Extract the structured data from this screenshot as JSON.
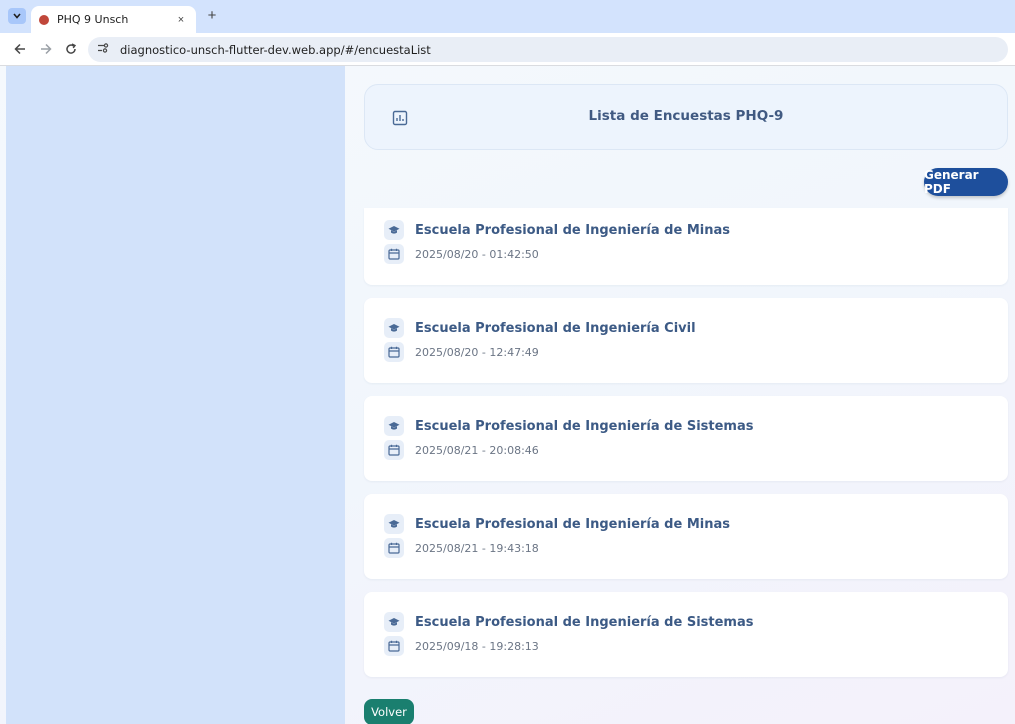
{
  "browser": {
    "tab_title": "PHQ 9 Unsch",
    "tab_close": "×",
    "new_tab": "+",
    "url": "diagnostico-unsch-flutter-dev.web.app/#/encuestaList"
  },
  "header": {
    "title": "Lista de Encuestas PHQ-9"
  },
  "actions": {
    "pdf_label": "Generar PDF",
    "back_label": "Volver"
  },
  "surveys": [
    {
      "school": "Escuela Profesional de Ingeniería de Minas",
      "date": "2025/08/20 - 01:42:50"
    },
    {
      "school": "Escuela Profesional de Ingeniería Civil",
      "date": "2025/08/20 - 12:47:49"
    },
    {
      "school": "Escuela Profesional de Ingeniería de Sistemas",
      "date": "2025/08/21 - 20:08:46"
    },
    {
      "school": "Escuela Profesional de Ingeniería de Minas",
      "date": "2025/08/21 - 19:43:18"
    },
    {
      "school": "Escuela Profesional de Ingeniería de Sistemas",
      "date": "2025/09/18 - 19:28:13"
    }
  ],
  "colors": {
    "primary": "#1e4f9c",
    "back_button": "#1a7f6f",
    "side_panel": "#d2e2fa"
  },
  "icons": {
    "header": "bar-chart-icon",
    "school": "graduation-cap-icon",
    "date": "calendar-icon"
  }
}
